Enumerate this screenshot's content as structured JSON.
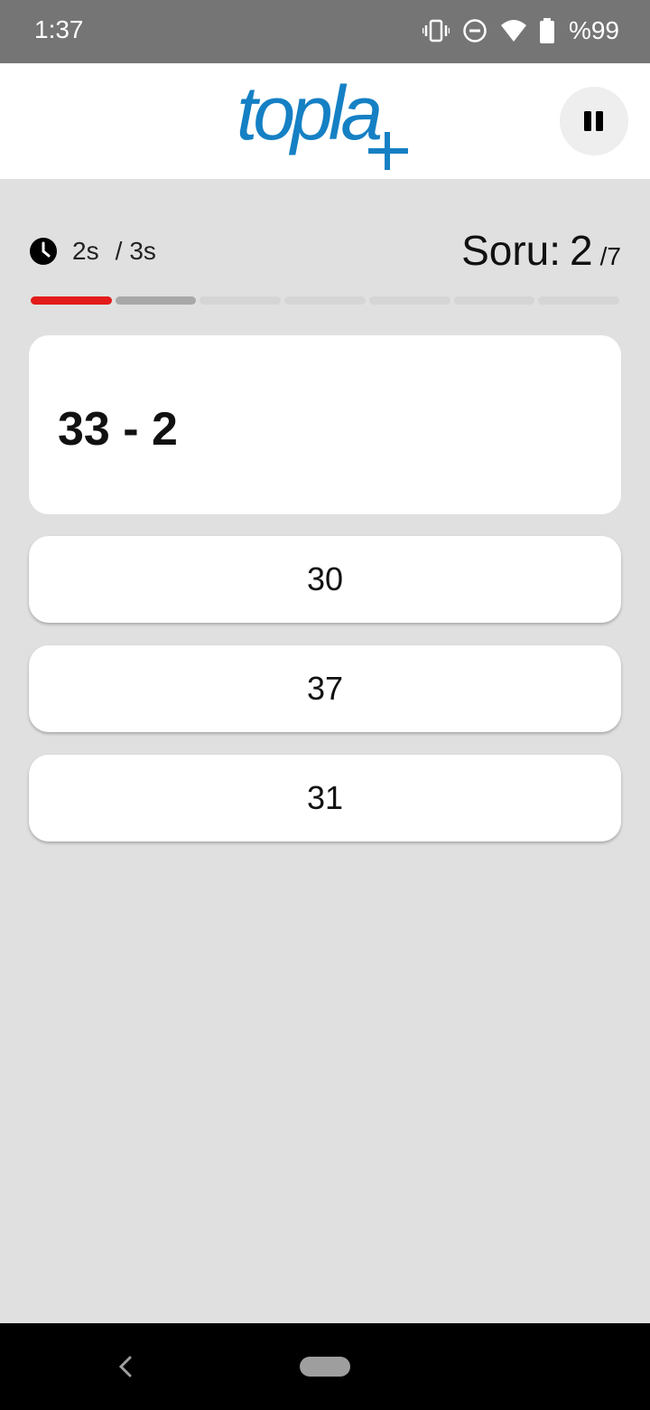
{
  "status_bar": {
    "time": "1:37",
    "battery": "%99",
    "wifi_badge": "4",
    "icons": [
      "vibrate-icon",
      "do-not-disturb-icon",
      "wifi-icon",
      "battery-icon"
    ]
  },
  "app_bar": {
    "logo_text": "topla",
    "logo_color": "#1580c4",
    "pause_icon": "pause-icon"
  },
  "quiz": {
    "timer_elapsed": "2s",
    "timer_limit": "3s",
    "question_label": "Soru:",
    "question_current": "2",
    "question_total": "/7",
    "progress_segments": 7,
    "expression": "33 - 2",
    "options": [
      "30",
      "37",
      "31"
    ]
  },
  "colors": {
    "accent": "#1580c4",
    "progress_active": "#e31b1b",
    "progress_current": "#a8a8a8",
    "background": "#e0e0e0"
  }
}
